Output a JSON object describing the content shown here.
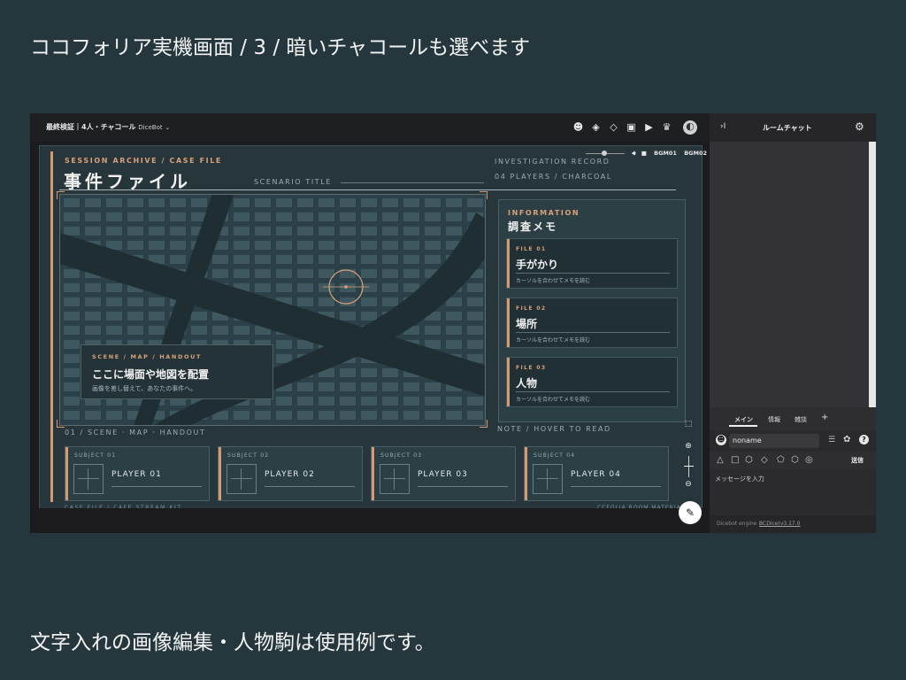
{
  "captions": {
    "top": "ココフォリア実機画面 / 3 / 暗いチャコールも選べます",
    "bottom": "文字入れの画像編集・人物駒は使用例です。"
  },
  "appbar": {
    "room_title": "最終検証｜4人・チャコール",
    "dicebot": "DiceBot",
    "icons": [
      "face-icon",
      "layers-icon",
      "layers-alt-icon",
      "chat-add-icon",
      "play-icon",
      "gallery-icon",
      "avatar-icon"
    ]
  },
  "board": {
    "session_label": "SESSION ARCHIVE / CASE FILE",
    "heading": "事件ファイル",
    "scenario_title": "SCENARIO TITLE",
    "record_label": "INVESTIGATION RECORD",
    "record_sub": "04 PLAYERS / CHARCOAL",
    "bgm1": "BGM01",
    "bgm2": "BGM02",
    "scene": {
      "label": "SCENE / MAP / HANDOUT",
      "title": "ここに場面や地図を配置",
      "desc": "画像を差し替えて、あなたの事件へ。"
    },
    "map_caption": "01 / SCENE · MAP · HANDOUT",
    "note": "NOTE / HOVER TO READ",
    "footer_left": "CASE FILE / CAFE STREAM KIT",
    "footer_right": "CCFOLIA ROOM MATERIAL"
  },
  "info": {
    "label": "INFORMATION",
    "title": "調査メモ",
    "files": [
      {
        "label": "FILE 01",
        "title": "手がかり",
        "desc": "カーソルを合わせてメモを読む"
      },
      {
        "label": "FILE 02",
        "title": "場所",
        "desc": "カーソルを合わせてメモを読む"
      },
      {
        "label": "FILE 03",
        "title": "人物",
        "desc": "カーソルを合わせてメモを読む"
      }
    ]
  },
  "players": [
    {
      "subject": "SUBJECT 01",
      "name": "PLAYER 01"
    },
    {
      "subject": "SUBJECT 02",
      "name": "PLAYER 02"
    },
    {
      "subject": "SUBJECT 03",
      "name": "PLAYER 03"
    },
    {
      "subject": "SUBJECT 04",
      "name": "PLAYER 04"
    }
  ],
  "chat": {
    "collapse": "›I",
    "title": "ルームチャット",
    "tabs": {
      "main": "メイン",
      "info": "情報",
      "talk": "雑談",
      "add": "+"
    },
    "name_value": "noname",
    "send": "送信",
    "placeholder": "メッセージを入力",
    "footer_prefix": "Dicebot engine :",
    "footer_link": "BCDice(v3.17.0"
  },
  "colors": {
    "accent": "#d39a73",
    "board": "#26363b",
    "page": "#25373d"
  }
}
